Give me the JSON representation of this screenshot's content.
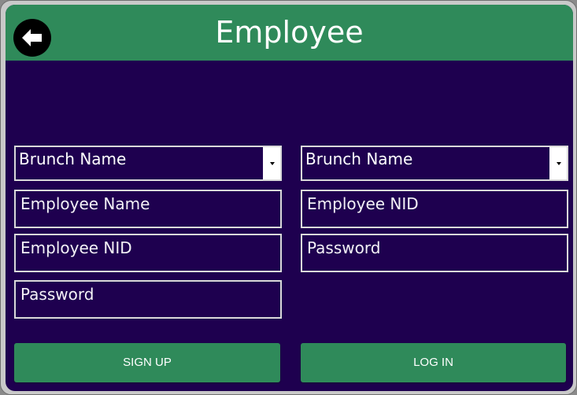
{
  "header": {
    "title": "Employee",
    "back_icon": "arrow-left-icon",
    "color": "#2f8a5a"
  },
  "theme": {
    "background": "#1e004f",
    "accent": "#2f8a5a",
    "field_border": "#d9d9d9"
  },
  "signup": {
    "branch_select": "Brunch Name",
    "employee_name": "Employee Name",
    "employee_nid": "Employee NID",
    "password": "Password",
    "button_label": "SIGN UP"
  },
  "login": {
    "branch_select": "Brunch Name",
    "employee_nid": "Employee NID",
    "password": "Password",
    "button_label": "LOG IN"
  }
}
